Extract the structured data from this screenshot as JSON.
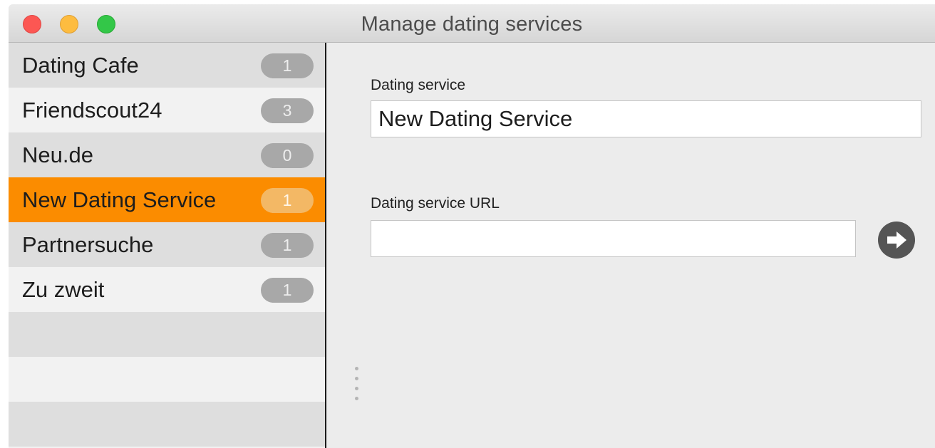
{
  "window": {
    "title": "Manage dating services"
  },
  "sidebar": {
    "items": [
      {
        "label": "Dating Cafe",
        "count": "1",
        "selected": false
      },
      {
        "label": "Friendscout24",
        "count": "3",
        "selected": false
      },
      {
        "label": "Neu.de",
        "count": "0",
        "selected": false
      },
      {
        "label": "New Dating Service",
        "count": "1",
        "selected": true
      },
      {
        "label": "Partnersuche",
        "count": "1",
        "selected": false
      },
      {
        "label": "Zu zweit",
        "count": "1",
        "selected": false
      }
    ]
  },
  "form": {
    "name_label": "Dating service",
    "name_value": "New Dating Service",
    "url_label": "Dating service URL",
    "url_value": "",
    "go_icon": "arrow-right-circle-icon"
  },
  "colors": {
    "selection": "#fb8c00",
    "close": "#fc5753",
    "minimize": "#fdbc40",
    "maximize": "#33c748"
  }
}
